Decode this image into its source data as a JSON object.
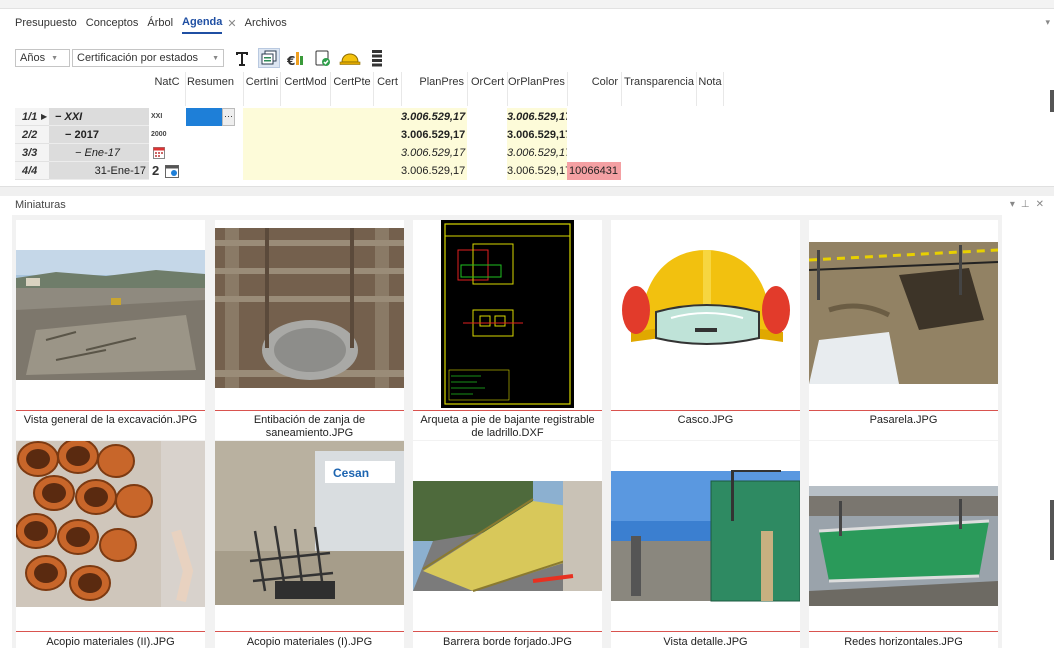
{
  "tabs": [
    {
      "label": "Presupuesto",
      "active": false
    },
    {
      "label": "Conceptos",
      "active": false
    },
    {
      "label": "Árbol",
      "active": false
    },
    {
      "label": "Agenda",
      "active": true
    },
    {
      "label": "Archivos",
      "active": false
    }
  ],
  "toolbar": {
    "period_value": "Años",
    "mode_value": "Certificación por estados"
  },
  "grid": {
    "headers": [
      "NatC",
      "Resumen",
      "CertIni",
      "CertMod",
      "CertPte",
      "Cert",
      "PlanPres",
      "OrCert",
      "OrPlanPres",
      "Color",
      "Transparencia",
      "Nota"
    ],
    "rows": [
      {
        "num": "1/1",
        "node": "− XXI",
        "natc": "XXI",
        "planpres": "3.006.529,17",
        "orplanpres": "3.006.529,17",
        "color": ""
      },
      {
        "num": "2/2",
        "node": "− 2017",
        "natc": "2000",
        "planpres": "3.006.529,17",
        "orplanpres": "3.006.529,17",
        "color": ""
      },
      {
        "num": "3/3",
        "node": "− Ene-17",
        "natc": "",
        "planpres": "3.006.529,17",
        "orplanpres": "3.006.529,17",
        "color": ""
      },
      {
        "num": "4/4",
        "node": "31-Ene-17",
        "natc": "2",
        "planpres": "3.006.529,17",
        "orplanpres": "3.006.529,17",
        "color": "10066431"
      }
    ]
  },
  "panel": {
    "title": "Miniaturas"
  },
  "thumbnails": [
    {
      "caption": "Vista general de la excavación.JPG"
    },
    {
      "caption": "Entibación de zanja de saneamiento.JPG"
    },
    {
      "caption": "Arqueta a pie de bajante registrable de ladrillo.DXF"
    },
    {
      "caption": "Casco.JPG"
    },
    {
      "caption": "Pasarela.JPG"
    },
    {
      "caption": "Acopio materiales (II).JPG"
    },
    {
      "caption": "Acopio materiales (I).JPG"
    },
    {
      "caption": "Barrera borde forjado.JPG"
    },
    {
      "caption": "Vista detalle.JPG"
    },
    {
      "caption": "Redes horizontales.JPG"
    }
  ],
  "colors": {
    "accent": "#1f4fa3",
    "selected_cell": "#1e7fd8",
    "yellow_cells": "#fdfbd9",
    "color_cell": "#f4a0a3"
  }
}
